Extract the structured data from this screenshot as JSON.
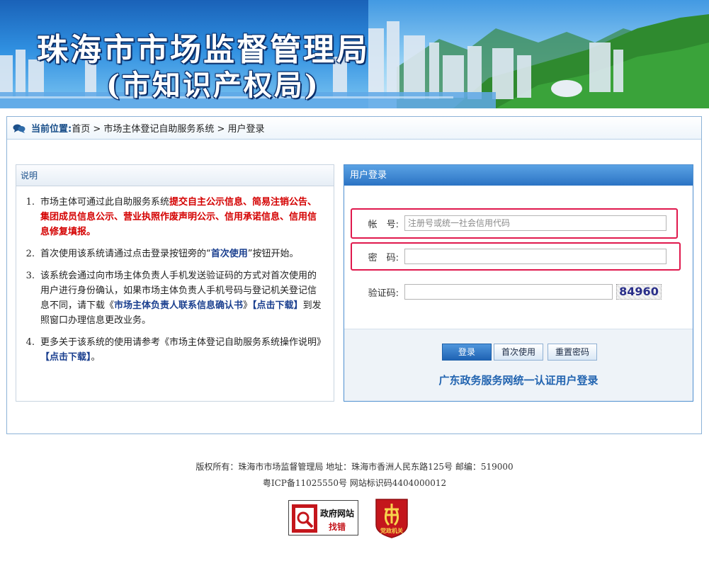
{
  "banner": {
    "title_line1": "珠海市市场监督管理局",
    "title_line2": "(市知识产权局)"
  },
  "breadcrumb": {
    "label": "当前位置:",
    "path": " 首页 > 市场主体登记自助服务系统 > 用户登录"
  },
  "notes": {
    "title": "说明",
    "items": [
      {
        "num": "1.",
        "pre": "市场主体可通过此自助服务系统",
        "red": "提交自主公示信息、简易注销公告、集团成员信息公示、营业执照作废声明公示、信用承诺信息、信用信息修复填报。"
      },
      {
        "num": "2.",
        "pre": "首次使用该系统请通过点击登录按钮旁的“",
        "blue": "首次使用",
        "post": "”按钮开始。"
      },
      {
        "num": "3.",
        "pre": "该系统会通过向市场主体负责人手机发送验证码的方式对首次使用的用户进行身份确认，如果市场主体负责人手机号码与登记机关登记信息不同，请下载《",
        "blue": "市场主体负责人联系信息确认书",
        "mid": "》",
        "blue2": "【点击下载】",
        "post": "到发照窗口办理信息更改业务。"
      },
      {
        "num": "4.",
        "pre": "更多关于该系统的使用请参考《市场主体登记自助服务系统操作说明》",
        "blue": "【点击下载】",
        "post": "。"
      }
    ]
  },
  "login": {
    "title": "用户登录",
    "account_label": "帐　号:",
    "account_placeholder": "注册号或统一社会信用代码",
    "account_value": "",
    "password_label": "密　码:",
    "password_value": "",
    "captcha_label": "验证码:",
    "captcha_value": "",
    "captcha_code": "84960",
    "login_button": "登录",
    "first_use_button": "首次使用",
    "reset_password_button": "重置密码",
    "gd_link": "广东政务服务网统一认证用户登录"
  },
  "footer": {
    "line1": "版权所有：珠海市市场监督管理局 地址：珠海市香洲人民东路125号 邮编：519000",
    "line2": "粤ICP备11025550号 网站标识码4404000012",
    "gov_badge_line1": "政府网站",
    "gov_badge_line2": "找错",
    "party_badge_text": "党政机关"
  },
  "colors": {
    "accent_blue": "#2b73c4",
    "highlight_red": "#e0194d",
    "notice_red": "#d40000",
    "link_blue": "#2264b0"
  },
  "icons": {
    "breadcrumb": "chat-bubbles-icon",
    "gov_badge": "magnifier-icon",
    "party_badge": "party-emblem-icon"
  }
}
